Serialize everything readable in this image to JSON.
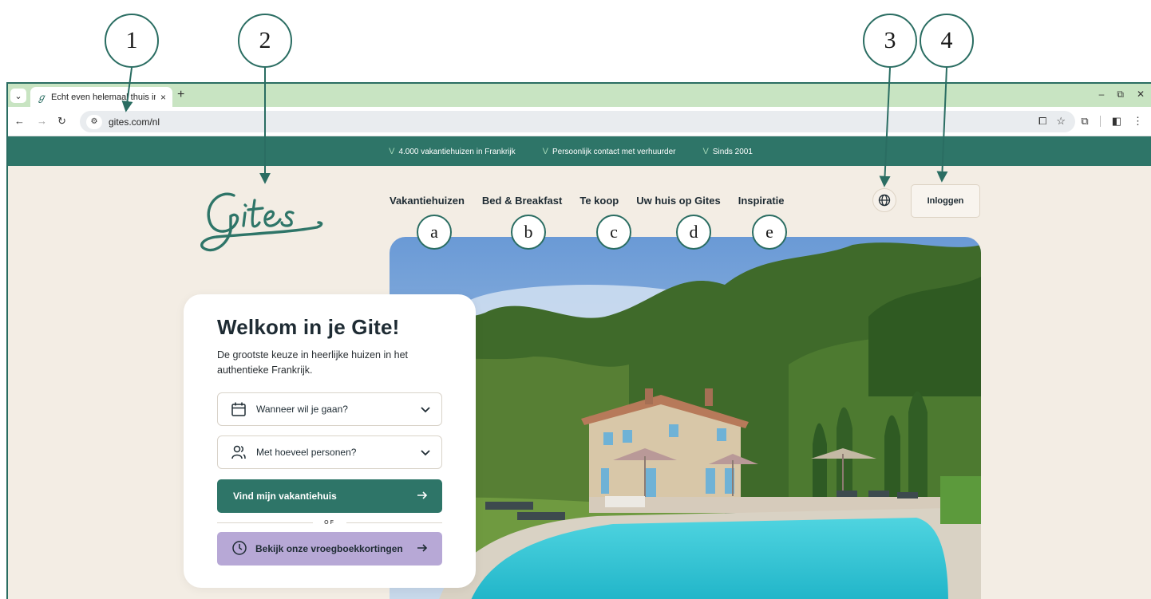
{
  "callouts": {
    "numbers": [
      "1",
      "2",
      "3",
      "4"
    ],
    "letters": [
      "a",
      "b",
      "c",
      "d",
      "e"
    ]
  },
  "browser": {
    "tab_title": "Echt even helemaal thuis in Fra",
    "tab_close": "×",
    "new_tab": "+",
    "url": "gites.com/nl",
    "accent_color": "#c8e4c2"
  },
  "promo": {
    "items": [
      "4.000 vakantiehuizen in Frankrijk",
      "Persoonlijk contact met verhuurder",
      "Sinds 2001"
    ],
    "check": "V",
    "color": "#2e7568"
  },
  "header": {
    "logo_text": "Gites",
    "nav": [
      "Vakantiehuizen",
      "Bed & Breakfast",
      "Te koop",
      "Uw huis op Gites",
      "Inspiratie"
    ],
    "language_icon": "globe-icon",
    "login_label": "Inloggen"
  },
  "card": {
    "title": "Welkom in je Gite!",
    "subtitle": "De grootste keuze in heerlijke huizen in het authentieke Frankrijk.",
    "date_placeholder": "Wanneer wil je gaan?",
    "persons_placeholder": "Met hoeveel personen?",
    "search_label": "Vind mijn vakantiehuis",
    "or_label": "OF",
    "early_booking_label": "Bekijk onze vroegboekkortingen",
    "primary_color": "#2e7568",
    "secondary_color": "#b7a8d6"
  }
}
